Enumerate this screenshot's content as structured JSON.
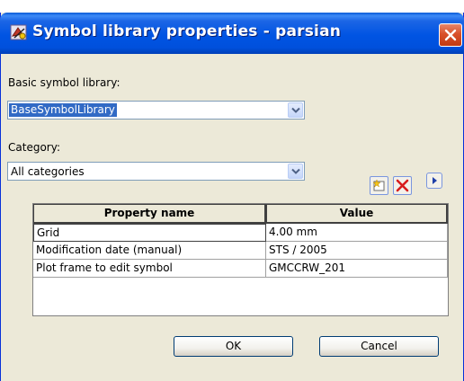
{
  "window": {
    "title": "Symbol library properties - parsian",
    "icons": {
      "app": "symbol-library-icon",
      "close": "close-icon"
    }
  },
  "basic_library": {
    "label": "Basic symbol library:",
    "selected": "BaseSymbolLibrary"
  },
  "category": {
    "label": "Category:",
    "selected": "All categories"
  },
  "toolbar": {
    "icons": [
      "new-property-icon",
      "delete-icon",
      "expand-right-icon"
    ]
  },
  "table": {
    "columns": [
      "Property name",
      "Value"
    ],
    "rows": [
      {
        "name": "Grid",
        "value": "4.00 mm"
      },
      {
        "name": "Modification date (manual)",
        "value": "STS / 2005"
      },
      {
        "name": "Plot frame to edit symbol",
        "value": "GMCCRW_201"
      }
    ]
  },
  "buttons": {
    "ok": "OK",
    "cancel": "Cancel"
  },
  "colors": {
    "titlebar": "#0054e3",
    "selection": "#316ac5",
    "close": "#d9502a",
    "face": "#ece9d8"
  }
}
